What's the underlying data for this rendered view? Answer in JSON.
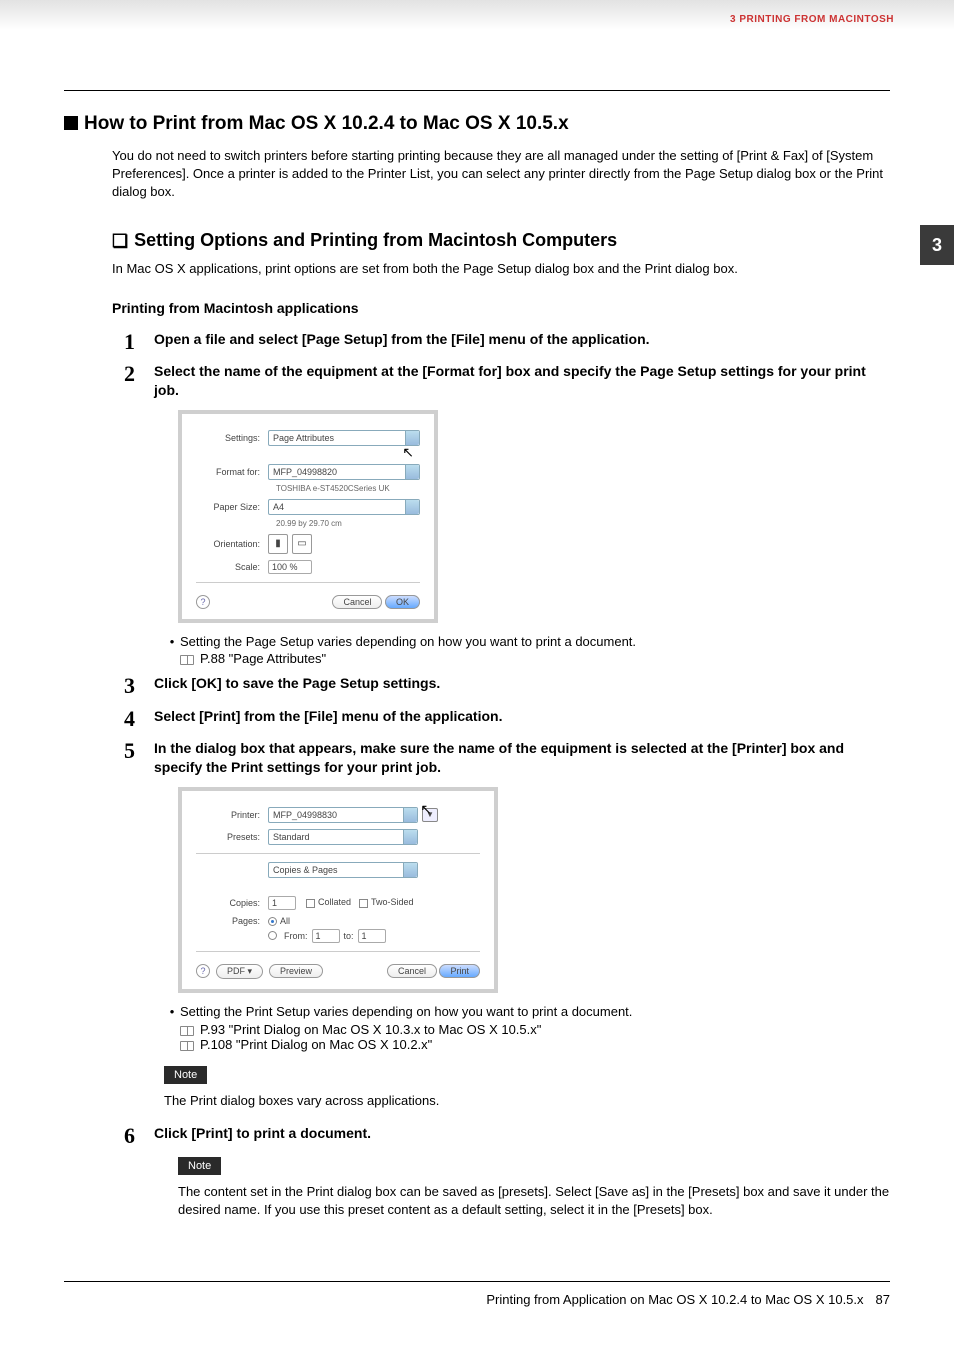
{
  "chapter_header": "3 PRINTING FROM MACINTOSH",
  "tab_number": "3",
  "h1": "How to Print from Mac OS X 10.2.4 to Mac OS X 10.5.x",
  "intro": "You do not need to switch printers before starting printing because they are all managed under the setting of [Print & Fax] of [System Preferences]. Once a printer is added to the Printer List, you can select any printer directly from the Page Setup dialog box or the Print dialog box.",
  "h2": "Setting Options and Printing from Macintosh Computers",
  "h2_desc": "In Mac OS X applications, print options are set from both the Page Setup dialog box and the Print dialog box.",
  "h3": "Printing from Macintosh applications",
  "steps": {
    "s1": {
      "num": "1",
      "title": "Open a file and select [Page Setup] from the [File] menu of the application."
    },
    "s2": {
      "num": "2",
      "title": "Select the name of the equipment at the [Format for] box and specify the Page Setup settings for your print job."
    },
    "s3": {
      "num": "3",
      "title": "Click [OK] to save the Page Setup settings."
    },
    "s4": {
      "num": "4",
      "title": "Select [Print] from the [File] menu of the application."
    },
    "s5": {
      "num": "5",
      "title": "In the dialog box that appears, make sure the name of the equipment is selected at the [Printer] box and specify the Print settings for your print job."
    },
    "s6": {
      "num": "6",
      "title": "Click [Print] to print a document."
    }
  },
  "dlg1": {
    "settings_lbl": "Settings:",
    "settings_val": "Page Attributes",
    "format_lbl": "Format for:",
    "format_val": "MFP_04998820",
    "format_sub": "TOSHIBA e-ST4520CSeries UK",
    "paper_lbl": "Paper Size:",
    "paper_val": "A4",
    "paper_sub": "20.99 by 29.70 cm",
    "orient_lbl": "Orientation:",
    "scale_lbl": "Scale:",
    "scale_val": "100 %",
    "cancel": "Cancel",
    "ok": "OK"
  },
  "s2_bullet": "Setting the Page Setup varies depending on how you want to print a document.",
  "s2_ref": "P.88 \"Page Attributes\"",
  "dlg2": {
    "printer_lbl": "Printer:",
    "printer_val": "MFP_04998830",
    "presets_lbl": "Presets:",
    "presets_val": "Standard",
    "section_val": "Copies & Pages",
    "copies_lbl": "Copies:",
    "copies_val": "1",
    "collated": "Collated",
    "twosided": "Two-Sided",
    "pages_lbl": "Pages:",
    "all": "All",
    "from": "From:",
    "from_val": "1",
    "to": "to:",
    "to_val": "1",
    "pdf": "PDF ▾",
    "preview": "Preview",
    "cancel": "Cancel",
    "print": "Print"
  },
  "s5_bullet": "Setting the Print Setup varies depending on how you want to print a document.",
  "s5_ref1": "P.93 \"Print Dialog on Mac OS X 10.3.x to Mac OS X 10.5.x\"",
  "s5_ref2": "P.108 \"Print Dialog on Mac OS X 10.2.x\"",
  "note_label": "Note",
  "note1_text": "The Print dialog boxes vary across applications.",
  "note2_text": "The content set in the Print dialog box can be saved as [presets]. Select [Save as] in the [Presets] box and save it under the desired name. If you use this preset content as a default setting, select it in the [Presets] box.",
  "footer_text": "Printing from Application on Mac OS X 10.2.4 to Mac OS X 10.5.x",
  "footer_page": "87"
}
